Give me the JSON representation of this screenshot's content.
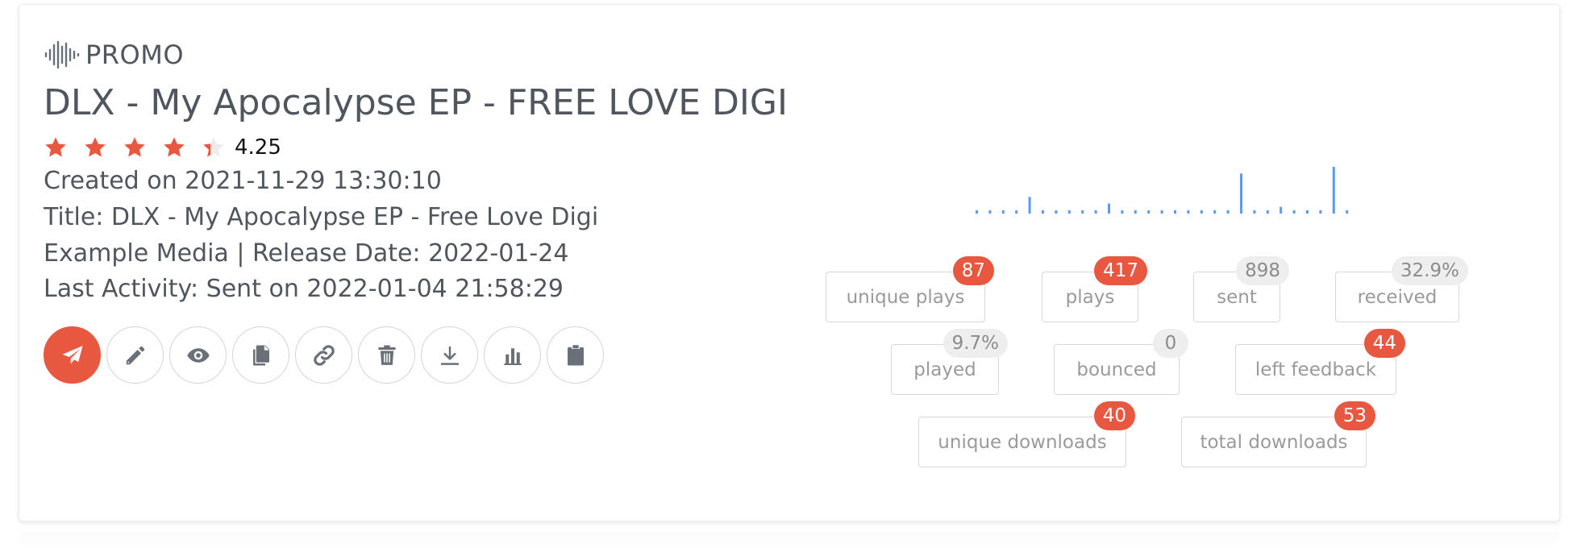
{
  "promo": {
    "brand_label": "PROMO",
    "brand_icon": "soundwave-icon",
    "title": "DLX - My Apocalypse EP - FREE LOVE DIGI",
    "rating": {
      "value": 4.25,
      "max": 5,
      "label": "4.25"
    },
    "created": "Created on 2021-11-29 13:30:10",
    "release_title": "Title: DLX - My Apocalypse EP - Free Love Digi",
    "media": "Example Media | Release Date: 2022-01-24",
    "last_activity": "Last Activity: Sent on 2022-01-04 21:58:29"
  },
  "actions": [
    {
      "name": "send",
      "icon": "paper-plane-icon",
      "primary": true
    },
    {
      "name": "edit",
      "icon": "pencil-icon"
    },
    {
      "name": "preview",
      "icon": "eye-icon"
    },
    {
      "name": "duplicate",
      "icon": "copy-icon"
    },
    {
      "name": "link",
      "icon": "link-icon"
    },
    {
      "name": "delete",
      "icon": "trash-icon"
    },
    {
      "name": "download",
      "icon": "download-icon"
    },
    {
      "name": "stats",
      "icon": "bar-chart-icon"
    },
    {
      "name": "clipboard",
      "icon": "clipboard-icon"
    }
  ],
  "stats": {
    "unique_plays": {
      "label": "unique plays",
      "badge": "87",
      "badge_style": "red"
    },
    "plays": {
      "label": "plays",
      "badge": "417",
      "badge_style": "red"
    },
    "sent": {
      "label": "sent",
      "badge": "898",
      "badge_style": "grey"
    },
    "received": {
      "label": "received",
      "badge": "32.9%",
      "badge_style": "grey"
    },
    "played": {
      "label": "played",
      "badge": "9.7%",
      "badge_style": "grey"
    },
    "bounced": {
      "label": "bounced",
      "badge": "0",
      "badge_style": "grey"
    },
    "left_feedback": {
      "label": "left feedback",
      "badge": "44",
      "badge_style": "red"
    },
    "unique_downloads": {
      "label": "unique downloads",
      "badge": "40",
      "badge_style": "red"
    },
    "total_downloads": {
      "label": "total downloads",
      "badge": "53",
      "badge_style": "red"
    }
  },
  "colors": {
    "accent": "#e8573f",
    "text": "#50565e",
    "badge_grey": "#eeeeee",
    "sparkline": "#5b9bf0"
  },
  "chart_data": {
    "type": "bar",
    "title": "",
    "xlabel": "",
    "ylabel": "",
    "values": [
      1,
      1,
      1,
      1,
      5,
      1,
      1,
      1,
      1,
      1,
      3,
      1,
      1,
      1,
      1,
      1,
      1,
      1,
      1,
      1,
      12,
      1,
      1,
      2,
      1,
      1,
      1,
      14,
      1
    ],
    "ylim": [
      0,
      14
    ]
  }
}
